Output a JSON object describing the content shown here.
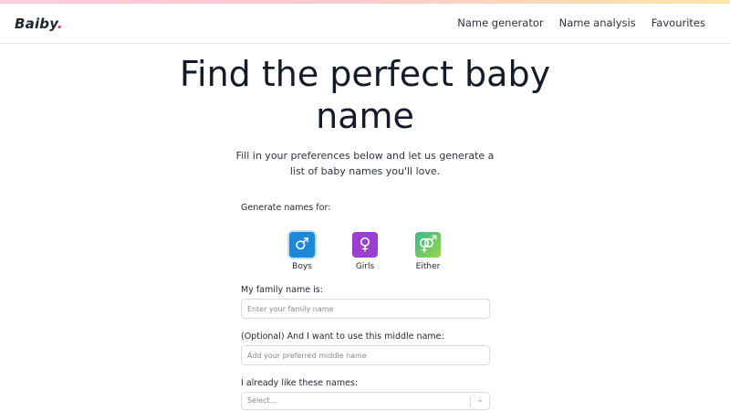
{
  "header": {
    "logo_text": "Baiby",
    "logo_dot": ".",
    "nav": [
      "Name generator",
      "Name analysis",
      "Favourites"
    ]
  },
  "hero": {
    "title": "Find the perfect baby name",
    "subtitle": "Fill in your preferences below and let us generate a list of baby names you'll love."
  },
  "form": {
    "generate_for_label": "Generate names for:",
    "genders": [
      {
        "label": "Boys",
        "icon": "male-icon",
        "glyph": "♂",
        "color": "#1e88d8",
        "selected": true
      },
      {
        "label": "Girls",
        "icon": "female-icon",
        "glyph": "♀",
        "color": "#9b3fd0",
        "selected": false
      },
      {
        "label": "Either",
        "icon": "either-gender-icon",
        "glyph": "⚤",
        "color": "#4fc47a",
        "selected": false
      }
    ],
    "family_name_label": "My family name is:",
    "family_name_placeholder": "Enter your family name",
    "family_name_value": "",
    "middle_name_label": "(Optional) And I want to use this middle name:",
    "middle_name_placeholder": "Add your preferred middle name",
    "middle_name_value": "",
    "liked_names_label": "I already like these names:",
    "liked_names_placeholder": "Select..."
  },
  "colors": {
    "accent_pink": "#e0356a",
    "boys_blue": "#1e88d8",
    "girls_purple": "#9b3fd0"
  }
}
